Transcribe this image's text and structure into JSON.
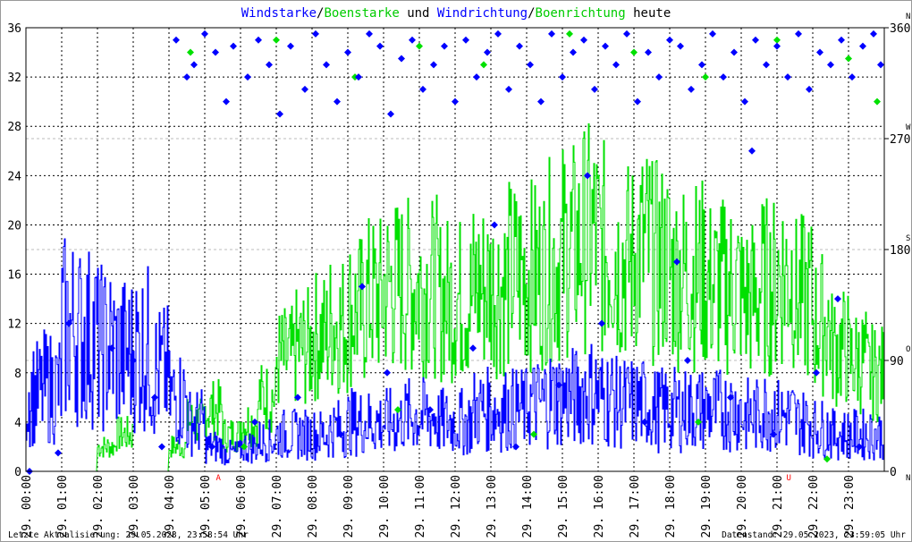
{
  "chart_data": {
    "type": "line",
    "title_parts": [
      {
        "text": "Windstarke",
        "color": "#0000ff"
      },
      {
        "text": "/",
        "color": "#000000"
      },
      {
        "text": "Boenstarke",
        "color": "#00cc00"
      },
      {
        "text": " und ",
        "color": "#000000"
      },
      {
        "text": "Windrichtung",
        "color": "#0000ff"
      },
      {
        "text": "/",
        "color": "#000000"
      },
      {
        "text": "Boenrichtung",
        "color": "#00cc00"
      },
      {
        "text": " heute",
        "color": "#000000"
      }
    ],
    "ylim": [
      0,
      36
    ],
    "yticks": [
      "0",
      "4",
      "8",
      "12",
      "16",
      "20",
      "24",
      "28",
      "32",
      "36"
    ],
    "y2lim": [
      0,
      360
    ],
    "y2ticks": [
      "0",
      "90",
      "180",
      "270",
      "360"
    ],
    "y2compass": [
      "N",
      "O",
      "S",
      "W",
      "N"
    ],
    "xlim_hours": [
      0,
      24
    ],
    "xticks": [
      "29. 00:00",
      "29. 01:00",
      "29. 02:00",
      "29. 03:00",
      "29. 04:00",
      "29. 05:00",
      "29. 06:00",
      "29. 07:00",
      "29. 08:00",
      "29. 09:00",
      "29. 10:00",
      "29. 11:00",
      "29. 12:00",
      "29. 13:00",
      "29. 14:00",
      "29. 15:00",
      "29. 16:00",
      "29. 17:00",
      "29. 18:00",
      "29. 19:00",
      "29. 20:00",
      "29. 21:00",
      "29. 22:00",
      "29. 23:00"
    ],
    "grid": true,
    "annotations": [
      {
        "hour": 5.38,
        "text": "A"
      },
      {
        "hour": 21.33,
        "text": "U"
      }
    ],
    "colors": {
      "wind": "#0000ff",
      "gust": "#00e000",
      "annotation": "#ff0000"
    },
    "step_hours": 0.5,
    "series": [
      {
        "name": "Windstarke",
        "values": [
          6.3,
          6.8,
          11.5,
          11,
          10,
          9.5,
          10,
          8,
          6,
          4,
          2,
          1.5,
          2,
          2.5,
          3,
          3,
          3,
          3.5,
          4,
          4,
          4,
          4.5,
          4.5,
          4,
          4,
          5,
          5,
          5,
          5.5,
          6,
          6,
          6.5,
          6,
          5.5,
          5.5,
          5,
          5,
          5,
          5,
          5,
          4.5,
          5,
          4.5,
          4,
          3.5,
          3,
          3,
          3
        ]
      },
      {
        "name": "Boenstarke",
        "values": [
          0,
          0,
          0,
          0,
          2,
          3,
          0,
          0,
          2,
          4,
          5,
          3,
          4,
          6,
          9,
          10,
          11,
          12,
          13,
          14,
          15,
          15,
          15,
          14,
          14,
          15,
          15,
          16,
          16,
          17,
          18,
          19,
          18,
          17,
          18,
          17,
          16,
          16,
          15,
          15,
          14,
          15,
          16,
          14,
          12,
          10,
          9,
          8
        ]
      }
    ],
    "direction_points": [
      [
        0.1,
        0
      ],
      [
        0.9,
        15
      ],
      [
        1.2,
        120
      ],
      [
        2.4,
        100
      ],
      [
        3.0,
        90
      ],
      [
        3.6,
        60
      ],
      [
        3.8,
        20
      ],
      [
        4.2,
        350
      ],
      [
        4.5,
        320
      ],
      [
        4.7,
        330
      ],
      [
        5.0,
        355
      ],
      [
        5.3,
        340
      ],
      [
        5.6,
        300
      ],
      [
        5.8,
        345
      ],
      [
        6.2,
        320
      ],
      [
        6.5,
        350
      ],
      [
        6.8,
        330
      ],
      [
        7.1,
        290
      ],
      [
        7.4,
        345
      ],
      [
        7.8,
        310
      ],
      [
        8.1,
        355
      ],
      [
        8.4,
        330
      ],
      [
        8.7,
        300
      ],
      [
        9.0,
        340
      ],
      [
        9.3,
        320
      ],
      [
        9.6,
        355
      ],
      [
        9.9,
        345
      ],
      [
        10.2,
        290
      ],
      [
        10.5,
        335
      ],
      [
        10.8,
        350
      ],
      [
        11.1,
        310
      ],
      [
        11.4,
        330
      ],
      [
        11.7,
        345
      ],
      [
        12.0,
        300
      ],
      [
        12.3,
        350
      ],
      [
        12.6,
        320
      ],
      [
        12.9,
        340
      ],
      [
        13.2,
        355
      ],
      [
        13.5,
        310
      ],
      [
        13.8,
        345
      ],
      [
        14.1,
        330
      ],
      [
        14.4,
        300
      ],
      [
        14.7,
        355
      ],
      [
        15.0,
        320
      ],
      [
        15.3,
        340
      ],
      [
        15.6,
        350
      ],
      [
        15.9,
        310
      ],
      [
        16.2,
        345
      ],
      [
        16.5,
        330
      ],
      [
        16.8,
        355
      ],
      [
        17.1,
        300
      ],
      [
        17.4,
        340
      ],
      [
        17.7,
        320
      ],
      [
        18.0,
        350
      ],
      [
        18.3,
        345
      ],
      [
        18.6,
        310
      ],
      [
        18.9,
        330
      ],
      [
        19.2,
        355
      ],
      [
        19.5,
        320
      ],
      [
        19.8,
        340
      ],
      [
        20.1,
        300
      ],
      [
        20.4,
        350
      ],
      [
        20.7,
        330
      ],
      [
        21.0,
        345
      ],
      [
        21.3,
        320
      ],
      [
        21.6,
        355
      ],
      [
        21.9,
        310
      ],
      [
        22.2,
        340
      ],
      [
        22.5,
        330
      ],
      [
        22.8,
        350
      ],
      [
        23.1,
        320
      ],
      [
        23.4,
        345
      ],
      [
        23.7,
        355
      ],
      [
        23.9,
        330
      ],
      [
        5.2,
        20
      ],
      [
        6.4,
        40
      ],
      [
        7.6,
        60
      ],
      [
        8.8,
        30
      ],
      [
        10.1,
        80
      ],
      [
        11.3,
        50
      ],
      [
        12.5,
        100
      ],
      [
        13.7,
        20
      ],
      [
        14.9,
        70
      ],
      [
        16.1,
        120
      ],
      [
        17.3,
        40
      ],
      [
        18.5,
        90
      ],
      [
        19.7,
        60
      ],
      [
        20.9,
        30
      ],
      [
        22.1,
        80
      ],
      [
        23.3,
        20
      ],
      [
        9.4,
        150
      ],
      [
        13.1,
        200
      ],
      [
        15.7,
        240
      ],
      [
        18.2,
        170
      ],
      [
        20.3,
        260
      ],
      [
        22.7,
        140
      ]
    ],
    "gust_direction_points": [
      [
        4.6,
        340
      ],
      [
        7.0,
        350
      ],
      [
        9.2,
        320
      ],
      [
        11.0,
        345
      ],
      [
        12.8,
        330
      ],
      [
        15.2,
        355
      ],
      [
        17.0,
        340
      ],
      [
        19.0,
        320
      ],
      [
        21.0,
        350
      ],
      [
        23.0,
        335
      ],
      [
        6.1,
        20
      ],
      [
        10.4,
        50
      ],
      [
        14.2,
        30
      ],
      [
        18.8,
        40
      ],
      [
        22.4,
        10
      ],
      [
        23.8,
        300
      ]
    ]
  },
  "footer": {
    "left": "Letzte Aktualisierung: 29.05.2023, 23:58:54 Uhr",
    "right": "Datenstand: 29.05.2023, 23:59:05 Uhr"
  }
}
